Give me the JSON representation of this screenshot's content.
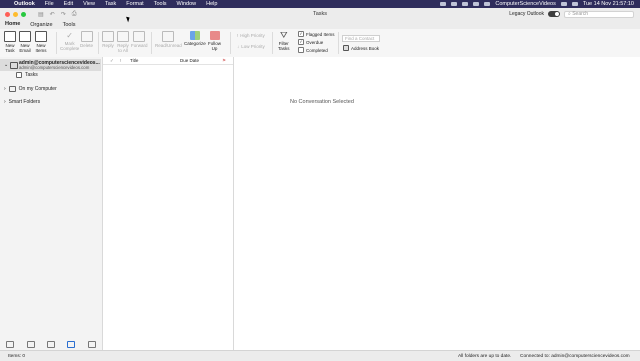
{
  "menubar": {
    "app_name": "Outlook",
    "items": [
      "File",
      "Edit",
      "View",
      "Task",
      "Format",
      "Tools",
      "Window",
      "Help"
    ],
    "status_text": "ComputerScienceVideos",
    "clock": "Tue 14 Nov  21:57:10"
  },
  "window": {
    "title": "Tasks",
    "legacy_label": "Legacy Outlook",
    "toggle": "On",
    "search_placeholder": "Search"
  },
  "tabs": [
    "Home",
    "Organize",
    "Tools"
  ],
  "ribbon": {
    "new_task": "New\nTask",
    "new_email": "New\nEmail",
    "new_items": "New\nItems",
    "mark_complete": "Mark\nComplete",
    "delete": "Delete",
    "reply": "Reply",
    "reply_all": "Reply\nto All",
    "forward": "Forward",
    "read_unread": "Read/Unread",
    "categorize": "Categorize",
    "follow_up": "Follow\nUp",
    "high_priority": "High Priority",
    "low_priority": "Low Priority",
    "filter_tasks": "Filter\nTasks",
    "flagged_items": "Flagged Items",
    "overdue": "Overdue",
    "completed": "Completed",
    "find_contact_placeholder": "Find a Contact",
    "address_book": "Address Book"
  },
  "sidebar": {
    "account_name": "admin@computersciencevideos...",
    "account_email": "admin@computersciencevideos.com",
    "tasks_folder": "Tasks",
    "on_my_computer": "On my Computer",
    "smart_folders": "Smart Folders"
  },
  "list": {
    "col_title": "Title",
    "col_due": "Due Date"
  },
  "reading": {
    "empty_text": "No Conversation Selected"
  },
  "status": {
    "items": "Items: 0",
    "sync": "All folders are up to date.",
    "connected": "Connected to: admin@computersciencevideos.com"
  },
  "colors": {
    "menubar_bg": "#2f2d5c",
    "accent": "#2a6ed0"
  }
}
